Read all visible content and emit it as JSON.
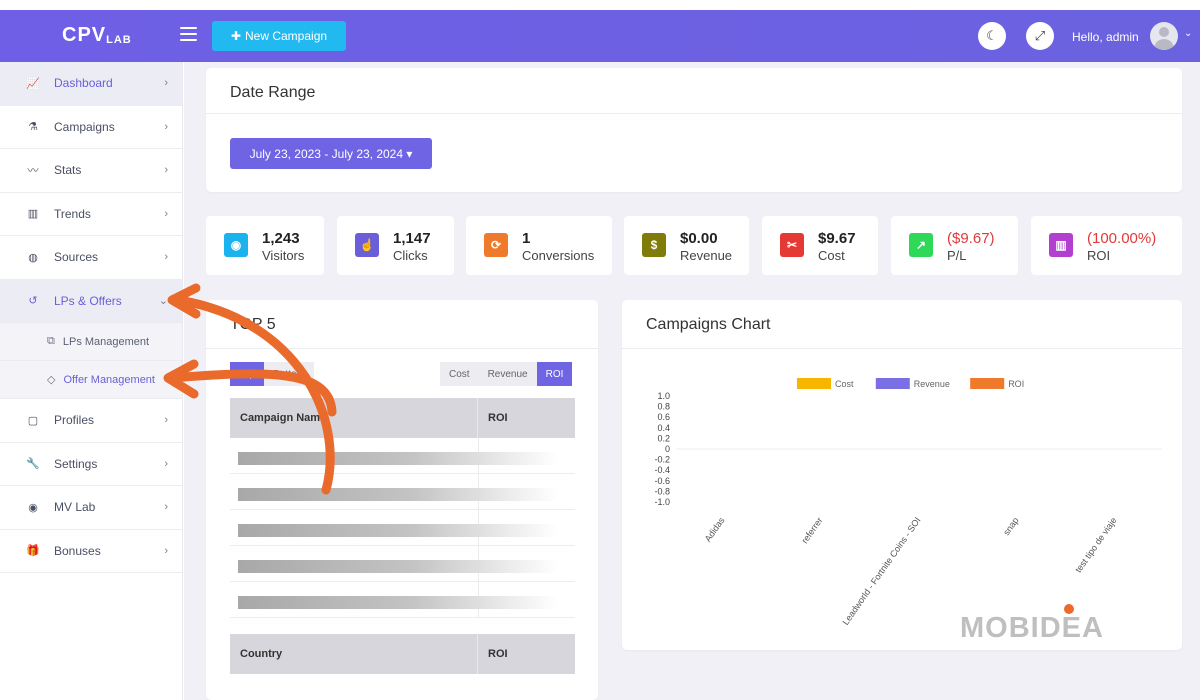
{
  "app": {
    "logo_main": "CPV",
    "logo_sub": "LAB"
  },
  "header": {
    "new_campaign_label": "New Campaign",
    "greeting": "Hello, admin",
    "icons": [
      "menu-icon",
      "moon-icon",
      "fullscreen-icon",
      "user-avatar",
      "chevron-down-icon"
    ]
  },
  "sidebar": {
    "items": [
      {
        "label": "Dashboard",
        "icon": "chart-line-icon"
      },
      {
        "label": "Campaigns",
        "icon": "flask-icon"
      },
      {
        "label": "Stats",
        "icon": "stats-icon"
      },
      {
        "label": "Trends",
        "icon": "columns-icon"
      },
      {
        "label": "Sources",
        "icon": "globe-icon"
      },
      {
        "label": "LPs & Offers",
        "icon": "history-icon"
      },
      {
        "label": "Profiles",
        "icon": "clipboard-icon"
      },
      {
        "label": "Settings",
        "icon": "wrench-icon"
      },
      {
        "label": "MV Lab",
        "icon": "mv-icon"
      },
      {
        "label": "Bonuses",
        "icon": "gift-icon"
      }
    ],
    "submenu": [
      {
        "label": "LPs Management",
        "icon": "copy-icon"
      },
      {
        "label": "Offer Management",
        "icon": "tag-icon"
      }
    ]
  },
  "date_range": {
    "title": "Date Range",
    "value": "July 23, 2023 - July 23, 2024"
  },
  "stats": [
    {
      "value": "1,243",
      "label": "Visitors",
      "color": "#1ab3ee",
      "icon": "eye-icon"
    },
    {
      "value": "1,147",
      "label": "Clicks",
      "color": "#6a5fd8",
      "icon": "pointer-icon"
    },
    {
      "value": "1",
      "label": "Conversions",
      "color": "#f07a2b",
      "icon": "sync-icon"
    },
    {
      "value": "$0.00",
      "label": "Revenue",
      "color": "#7f7c0a",
      "icon": "dollar-icon"
    },
    {
      "value": "$9.67",
      "label": "Cost",
      "color": "#e53935",
      "icon": "scissors-icon"
    },
    {
      "value": "($9.67)",
      "label": "P/L",
      "color": "#2ed957",
      "icon": "trend-icon"
    },
    {
      "value": "(100.00%)",
      "label": "ROI",
      "color": "#b23fcf",
      "icon": "bar-chart-icon"
    }
  ],
  "top_card": {
    "title": "TOP 5",
    "toggle": [
      "Top",
      "Bottom"
    ],
    "metric": [
      "Cost",
      "Revenue",
      "ROI"
    ],
    "campaign_table": {
      "headers": [
        "Campaign Name",
        "ROI"
      ]
    },
    "country_table": {
      "headers": [
        "Country",
        "ROI"
      ]
    }
  },
  "chart": {
    "title": "Campaigns Chart",
    "watermark": "MOBIDEA"
  },
  "chart_data": {
    "type": "bar",
    "categories": [
      "Adidas",
      "referrer",
      "Leadworld - Fortnite Coins - SOI",
      "snap",
      "test tipo de viaje"
    ],
    "series": [
      {
        "name": "Cost",
        "color": "#f7b500",
        "values": [
          0,
          0,
          0,
          0,
          0
        ]
      },
      {
        "name": "Revenue",
        "color": "#7b6fe6",
        "values": [
          0,
          0,
          0,
          0,
          0
        ]
      },
      {
        "name": "ROI",
        "color": "#f07a2b",
        "values": [
          0,
          0,
          0,
          0,
          0
        ]
      }
    ],
    "yticks": [
      "1.0",
      "0.8",
      "0.6",
      "0.4",
      "0.2",
      "0",
      "-0.2",
      "-0.4",
      "-0.6",
      "-0.8",
      "-1.0"
    ],
    "ylim": [
      -1.0,
      1.0
    ],
    "legend": "top-center",
    "grid": false
  }
}
